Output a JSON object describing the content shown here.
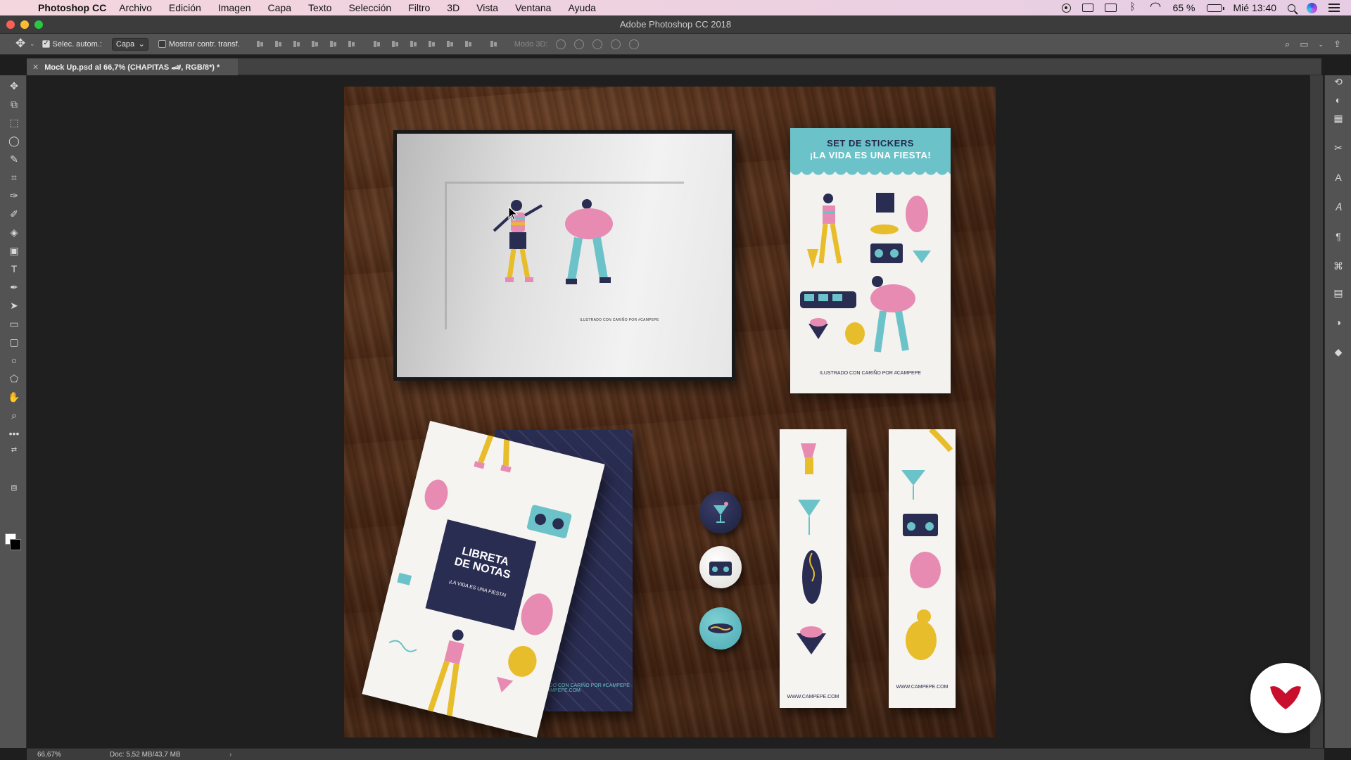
{
  "menubar": {
    "app_name": "Photoshop CC",
    "items": [
      "Archivo",
      "Edición",
      "Imagen",
      "Capa",
      "Texto",
      "Selección",
      "Filtro",
      "3D",
      "Vista",
      "Ventana",
      "Ayuda"
    ],
    "battery": "65 %",
    "clock": "Mié 13:40"
  },
  "window": {
    "title": "Adobe Photoshop CC 2018"
  },
  "options": {
    "auto_select_label": "Selec. autom.:",
    "auto_select_checked": true,
    "layer_select_value": "Capa",
    "transform_label": "Mostrar contr. transf.",
    "transform_checked": false,
    "mode3d_label": "Modo 3D:"
  },
  "document_tab": {
    "name": "Mock Up.psd al 66,7% (CHAPITAS 🏎, RGB/8*) *"
  },
  "artwork": {
    "frame_caption": "ILUSTRADO CON CARIÑO POR #CAMPEPE",
    "sticker_title_1": "SET DE STICKERS",
    "sticker_title_2": "¡LA VIDA ES UNA FIESTA!",
    "sticker_footer": "ILUSTRADO CON CARIÑO POR #CAMPEPE",
    "notebook_title_1": "LIBRETA",
    "notebook_title_2": "DE NOTAS",
    "notebook_subtitle": "¡LA VIDA ES UNA FIESTA!",
    "notebook_back_credit_1": "ILUSTRADO CON CARIÑO POR #CAMPEPE",
    "notebook_back_credit_2": "WWW.CAMPEPE.COM",
    "bookmark_1_url": "WWW.CAMPEPE.COM",
    "bookmark_2_url": "WWW.CAMPEPE.COM"
  },
  "status": {
    "zoom": "66,67%",
    "doc": "Doc: 5,52 MB/43,7 MB",
    "arrow": "›"
  },
  "colors": {
    "pink": "#e88bb2",
    "teal": "#6bc3c9",
    "yellow": "#e8bd2b",
    "navy": "#24284a",
    "logo_red": "#c8102e"
  }
}
